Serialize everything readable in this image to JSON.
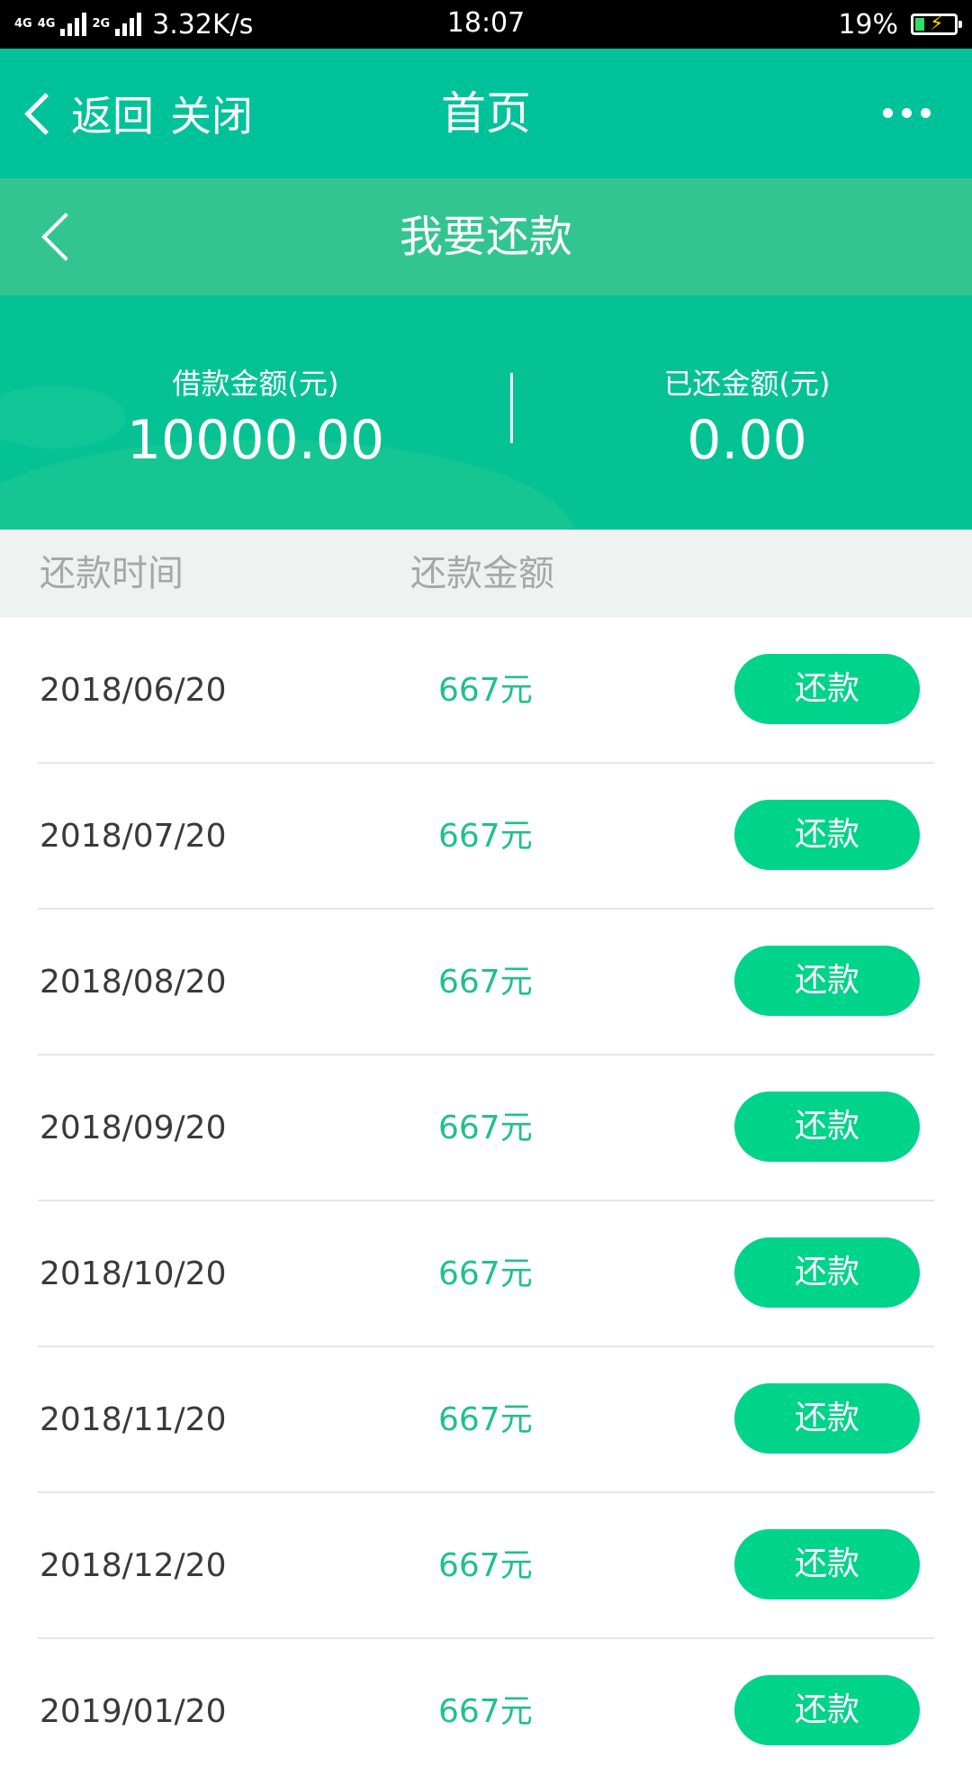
{
  "status_bar": {
    "network_1": "4G",
    "network_2": "4G",
    "network_3": "2G",
    "speed": "3.32K/s",
    "time": "18:07",
    "battery": "19%"
  },
  "titlebar": {
    "back_label": "返回",
    "close_label": "关闭",
    "title": "首页"
  },
  "subheader": {
    "title": "我要还款"
  },
  "summary": {
    "loan_label": "借款金额(元)",
    "loan_value": "10000.00",
    "repaid_label": "已还金额(元)",
    "repaid_value": "0.00"
  },
  "table": {
    "header_time": "还款时间",
    "header_amount": "还款金额",
    "rows": [
      {
        "date": "2018/06/20",
        "amount": "667元",
        "action": "还款"
      },
      {
        "date": "2018/07/20",
        "amount": "667元",
        "action": "还款"
      },
      {
        "date": "2018/08/20",
        "amount": "667元",
        "action": "还款"
      },
      {
        "date": "2018/09/20",
        "amount": "667元",
        "action": "还款"
      },
      {
        "date": "2018/10/20",
        "amount": "667元",
        "action": "还款"
      },
      {
        "date": "2018/11/20",
        "amount": "667元",
        "action": "还款"
      },
      {
        "date": "2018/12/20",
        "amount": "667元",
        "action": "还款"
      },
      {
        "date": "2019/01/20",
        "amount": "667元",
        "action": "还款"
      }
    ]
  },
  "colors": {
    "primary": "#00c29a",
    "accent_button": "#00d38a",
    "amount_text": "#20c08d"
  }
}
